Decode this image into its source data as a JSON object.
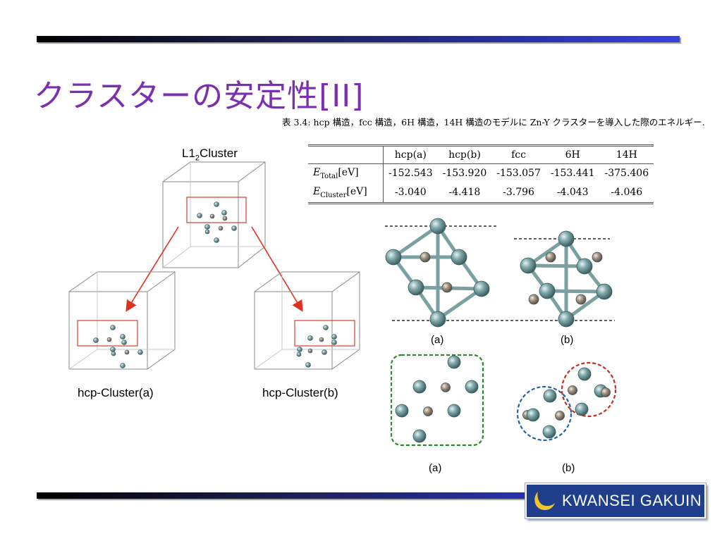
{
  "slide": {
    "title": "クラスターの安定性[II]",
    "caption": "表 3.4: hcp 構造，fcc 構造，6H 構造，14H 構造のモデルに Zn-Y クラスターを導入した際のエネルギー.",
    "table": {
      "columns": [
        "hcp(a)",
        "hcp(b)",
        "fcc",
        "6H",
        "14H"
      ],
      "rows": [
        {
          "label_main": "E",
          "label_sub": "Total",
          "label_unit": "[eV]",
          "values": [
            "-152.543",
            "-153.920",
            "-153.057",
            "-153.441",
            "-375.406"
          ]
        },
        {
          "label_main": "E",
          "label_sub": "Cluster",
          "label_unit": "[eV]",
          "values": [
            "-3.040",
            "-4.418",
            "-3.796",
            "-4.043",
            "-4.046"
          ]
        }
      ]
    },
    "labels": {
      "l12_cluster_main": "L1",
      "l12_cluster_sub": "2",
      "l12_cluster_tail": "Cluster",
      "hcp_cluster_a": "hcp-Cluster(a)",
      "hcp_cluster_b": "hcp-Cluster(b)",
      "struct_a": "(a)",
      "struct_b": "(b)",
      "cluster_a": "(a)",
      "cluster_b": "(b)"
    },
    "logo": {
      "text": "KWANSEI GAKUIN"
    },
    "colors": {
      "title": "#7c2fb0",
      "arrow": "#e03020",
      "highlight_box": "#d04030",
      "green_dashed": "#2a8a2a",
      "blue_dashed": "#2060b0",
      "red_dashed": "#c03020",
      "large_atom": "#6e9a9c",
      "small_atom": "#9a8a7a",
      "logo_bg": "#1f3f8c"
    }
  }
}
